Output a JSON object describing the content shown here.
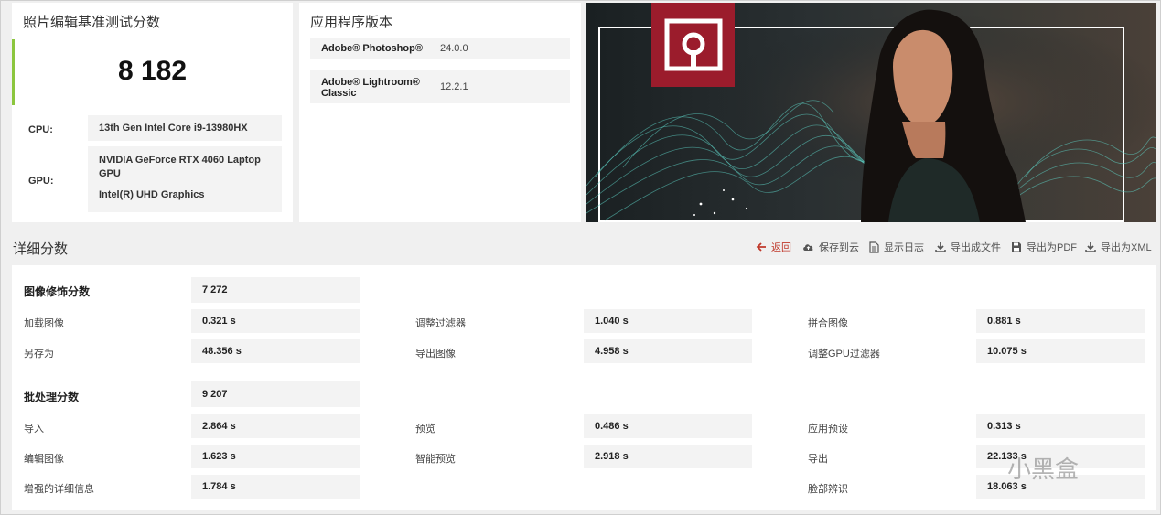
{
  "score_card": {
    "title": "照片编辑基准测试分数",
    "score": "8 182",
    "cpu_label": "CPU:",
    "cpu_value": "13th Gen Intel Core i9-13980HX",
    "gpu_label": "GPU:",
    "gpu_value_1": "NVIDIA GeForce RTX 4060 Laptop GPU",
    "gpu_value_2": "Intel(R) UHD Graphics"
  },
  "version_card": {
    "title": "应用程序版本",
    "apps": [
      {
        "name": "Adobe® Photoshop®",
        "version": "24.0.0"
      },
      {
        "name": "Adobe® Lightroom® Classic",
        "version": "12.2.1"
      }
    ]
  },
  "details": {
    "title": "详细分数",
    "toolbar": {
      "back": "返回",
      "save_cloud": "保存到云",
      "show_log": "显示日志",
      "export_file": "导出成文件",
      "export_pdf": "导出为PDF",
      "export_xml": "导出为XML"
    },
    "retouch": {
      "label": "图像修饰分数",
      "score": "7 272",
      "items": [
        {
          "label": "加载图像",
          "value": "0.321 s"
        },
        {
          "label": "调整过滤器",
          "value": "1.040 s"
        },
        {
          "label": "拼合图像",
          "value": "0.881 s"
        },
        {
          "label": "另存为",
          "value": "48.356 s"
        },
        {
          "label": "导出图像",
          "value": "4.958 s"
        },
        {
          "label": "调整GPU过滤器",
          "value": "10.075 s"
        }
      ]
    },
    "batch": {
      "label": "批处理分数",
      "score": "9 207",
      "items": [
        {
          "label": "导入",
          "value": "2.864 s"
        },
        {
          "label": "预览",
          "value": "0.486 s"
        },
        {
          "label": "应用预设",
          "value": "0.313 s"
        },
        {
          "label": "编辑图像",
          "value": "1.623 s"
        },
        {
          "label": "智能预览",
          "value": "2.918 s"
        },
        {
          "label": "导出",
          "value": "22.133 s"
        },
        {
          "label": "增强的详细信息",
          "value": "1.784 s"
        },
        {
          "label": "脸部辨识",
          "value": "18.063 s"
        }
      ]
    }
  },
  "watermark": "小黑盒",
  "colors": {
    "accent_green": "#8cc63e",
    "logo_red": "#9b1c2c",
    "back_red": "#c0392b"
  }
}
